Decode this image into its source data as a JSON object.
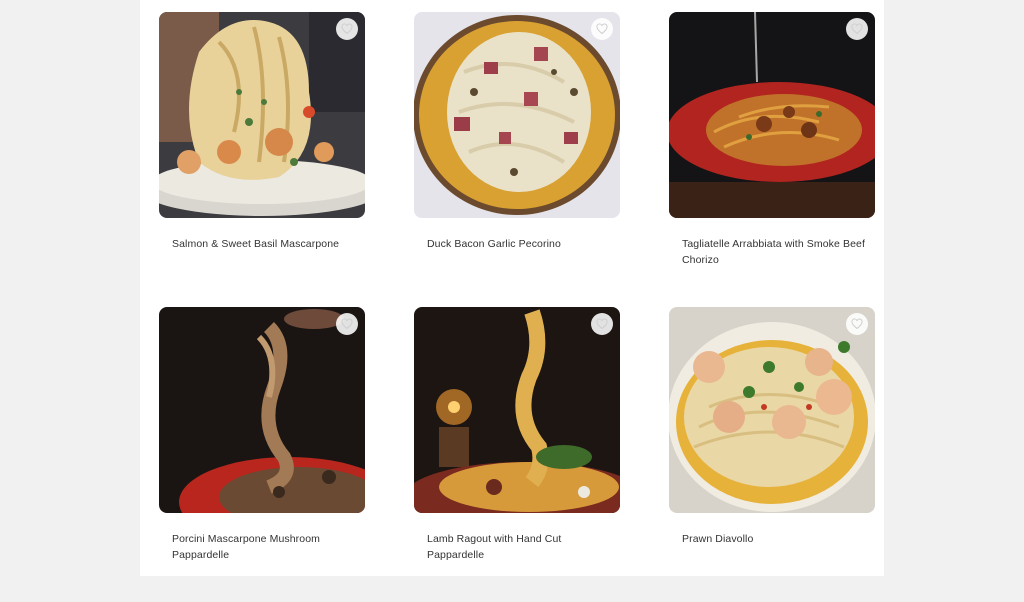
{
  "dishes": [
    {
      "name": "Salmon & Sweet Basil Mascarpone",
      "image": "salmon-basil-mascarpone-photo"
    },
    {
      "name": "Duck Bacon Garlic Pecorino",
      "image": "duck-bacon-pecorino-photo"
    },
    {
      "name": "Tagliatelle Arrabbiata with Smoke Beef Chorizo",
      "image": "tagliatelle-arrabbiata-photo"
    },
    {
      "name": "Porcini Mascarpone Mushroom Pappardelle",
      "image": "porcini-pappardelle-photo"
    },
    {
      "name": "Lamb Ragout with Hand Cut Pappardelle",
      "image": "lamb-ragout-photo"
    },
    {
      "name": "Prawn Diavollo",
      "image": "prawn-diavollo-photo"
    }
  ],
  "icons": {
    "favorite": "heart-icon"
  },
  "colors": {
    "page_background": "#ffffff",
    "outer_background": "#f1f1f1",
    "text": "#333333"
  }
}
